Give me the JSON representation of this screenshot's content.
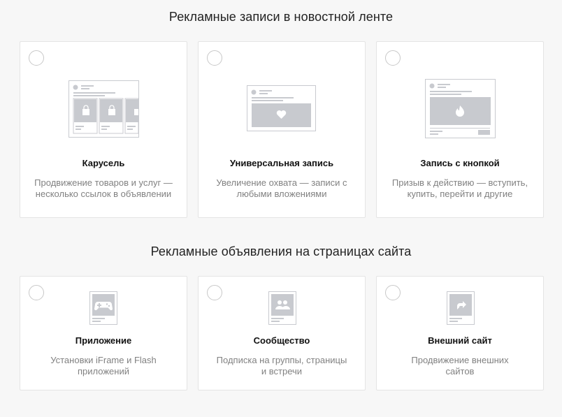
{
  "sections": [
    {
      "title": "Рекламные записи в новостной ленте",
      "cards": [
        {
          "title": "Карусель",
          "desc_line1": "Продвижение товаров и услуг —",
          "desc_line2": "несколько ссылок в объявлении",
          "icon": "carousel-icon"
        },
        {
          "title": "Универсальная запись",
          "desc_line1": "Увеличение охвата — записи с",
          "desc_line2": "любыми вложениями",
          "icon": "universal-post-icon"
        },
        {
          "title": "Запись с кнопкой",
          "desc_line1": "Призыв к действию — вступить,",
          "desc_line2": "купить, перейти и другие",
          "icon": "button-post-icon"
        }
      ]
    },
    {
      "title": "Рекламные объявления на страницах сайта",
      "cards": [
        {
          "title": "Приложение",
          "desc_line1": "Установки iFrame и Flash",
          "desc_line2": "приложений",
          "icon": "gamepad-icon"
        },
        {
          "title": "Сообщество",
          "desc_line1": "Подписка на группы, страницы",
          "desc_line2": "и встречи",
          "icon": "community-icon"
        },
        {
          "title": "Внешний сайт",
          "desc_line1": "Продвижение внешних",
          "desc_line2": "сайтов",
          "icon": "external-link-icon"
        }
      ]
    }
  ],
  "colors": {
    "background": "#f7f7f7",
    "card_border": "#e4e4e4",
    "illustration_gray": "#c8cacf",
    "text_muted": "#818181"
  }
}
